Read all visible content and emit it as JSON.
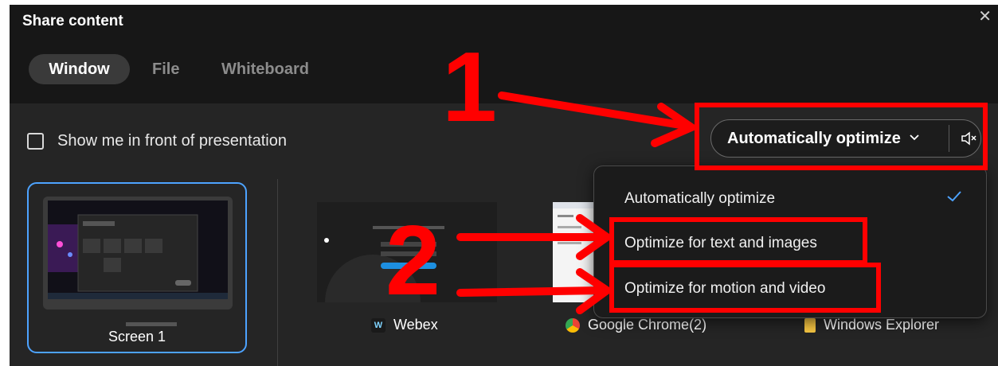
{
  "dialog": {
    "title": "Share content",
    "close_glyph": "✕",
    "tabs": [
      {
        "label": "Window",
        "selected": true
      },
      {
        "label": "File",
        "selected": false
      },
      {
        "label": "Whiteboard",
        "selected": false
      }
    ]
  },
  "options": {
    "show_me_label": "Show me in front of presentation",
    "show_me_checked": false,
    "optimize_label": "Automatically optimize",
    "chevron_glyph": "﹀",
    "mute_icon": "speaker-muted-icon"
  },
  "dropdown": {
    "items": [
      {
        "label": "Automatically optimize",
        "selected": true
      },
      {
        "label": "Optimize for text and images",
        "selected": false
      },
      {
        "label": "Optimize for motion and video",
        "selected": false
      }
    ],
    "check_color": "#4da3ff"
  },
  "sources": {
    "screen_label": "Screen 1",
    "apps": [
      {
        "label": "Webex",
        "icon": "webex-icon"
      },
      {
        "label": "Google Chrome(2)",
        "icon": "chrome-icon"
      },
      {
        "label": "Windows Explorer",
        "icon": "folder-icon"
      }
    ]
  },
  "annotations": {
    "step1": "1",
    "step2": "2",
    "color": "#ff0000"
  },
  "colors": {
    "header_bg": "#171717",
    "content_bg": "#252525",
    "accent": "#4da3ff"
  }
}
